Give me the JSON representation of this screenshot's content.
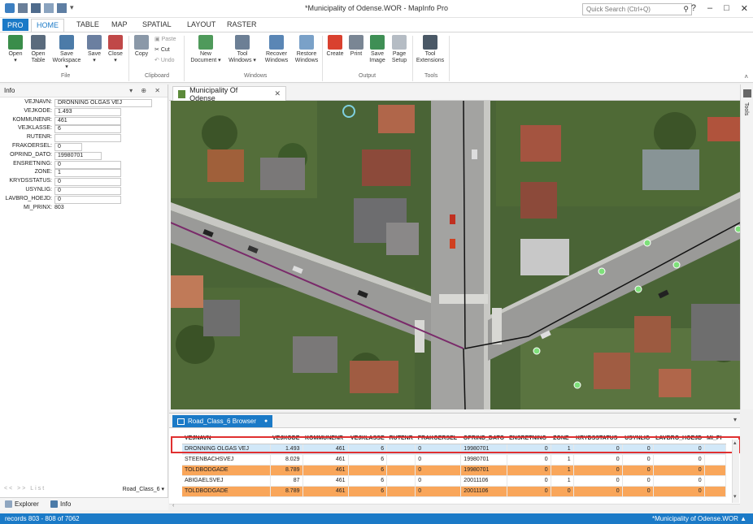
{
  "window": {
    "title": "*Municipality of Odense.WOR - MapInfo Pro",
    "quick_search_placeholder": "Quick Search (Ctrl+Q)",
    "help": "?",
    "minimize": "–",
    "maximize": "□",
    "close": "✕"
  },
  "ribbon_tabs": [
    "PRO",
    "HOME",
    "TABLE",
    "MAP",
    "SPATIAL",
    "LAYOUT",
    "RASTER"
  ],
  "ribbon": {
    "file": {
      "label": "File",
      "open": "Open",
      "open_table": "Open Table",
      "save_workspace": "Save Workspace",
      "save": "Save",
      "close": "Close"
    },
    "clipboard": {
      "label": "Clipboard",
      "copy": "Copy",
      "paste": "Paste",
      "cut": "Cut",
      "undo": "Undo"
    },
    "windows": {
      "label": "Windows",
      "new_document": "New Document",
      "tool_windows": "Tool Windows",
      "recover_windows": "Recover Windows",
      "restore_windows": "Restore Windows"
    },
    "output": {
      "label": "Output",
      "create": "Create",
      "print": "Print",
      "save_image": "Save Image",
      "page_setup": "Page Setup"
    },
    "tools": {
      "label": "Tools",
      "tool_extensions": "Tool Extensions"
    }
  },
  "info_panel": {
    "title": "Info",
    "fields": [
      {
        "label": "VEJNAVN:",
        "value": "DRONNING OLGAS VEJ"
      },
      {
        "label": "VEJKODE:",
        "value": "1.493"
      },
      {
        "label": "KOMMUNENR:",
        "value": "461"
      },
      {
        "label": "VEJKLASSE:",
        "value": "6"
      },
      {
        "label": "RUTENR:",
        "value": ""
      },
      {
        "label": "FRAKOERSEL:",
        "value": "0"
      },
      {
        "label": "OPRIND_DATO:",
        "value": "19980701"
      },
      {
        "label": "ENSRETNING:",
        "value": "0"
      },
      {
        "label": "ZONE:",
        "value": "1"
      },
      {
        "label": "KRYDSSTATUS:",
        "value": "0"
      },
      {
        "label": "USYNLIG:",
        "value": "0"
      },
      {
        "label": "LAVBRO_HOEJD:",
        "value": "0"
      },
      {
        "label": "MI_PRINX:",
        "value": "803"
      }
    ],
    "nav_buttons": "<< >> List",
    "layer_name": "Road_Class_6",
    "tabs": [
      "Explorer",
      "Info"
    ]
  },
  "map_window": {
    "tab_title": "Municipality Of Odense",
    "tools_label": "Tools"
  },
  "browser": {
    "tab_title": "Road_Class_6 Browser",
    "columns": [
      "VEJNAVN",
      "VEJKODE",
      "KOMMUNENR",
      "VEJKLASSE",
      "RUTENR",
      "FRAKOERSEL",
      "OPRIND_DATO",
      "ENSRETNING",
      "ZONE",
      "KRYDSSTATUS",
      "USYNLIG",
      "LAVBRO_HOEJD",
      "MI_PI"
    ],
    "rows": [
      [
        "DRONNING OLGAS VEJ",
        "1.493",
        "461",
        "6",
        "",
        "0",
        "19980701",
        "0",
        "1",
        "0",
        "0",
        "0",
        ""
      ],
      [
        "STEENBACHSVEJ",
        "8.029",
        "461",
        "6",
        "",
        "0",
        "19980701",
        "0",
        "1",
        "0",
        "0",
        "0",
        ""
      ],
      [
        "TOLDBODGADE",
        "8.789",
        "461",
        "6",
        "",
        "0",
        "19980701",
        "0",
        "1",
        "0",
        "0",
        "0",
        ""
      ],
      [
        "ABIGAELSVEJ",
        "87",
        "461",
        "6",
        "",
        "0",
        "20011106",
        "0",
        "1",
        "0",
        "0",
        "0",
        ""
      ],
      [
        "TOLDBODGADE",
        "8.789",
        "461",
        "6",
        "",
        "0",
        "20011106",
        "0",
        "0",
        "0",
        "0",
        "0",
        ""
      ]
    ]
  },
  "status": {
    "records": "records 803 - 808 of 7062",
    "workspace": "*Municipality of Odense.WOR"
  },
  "colors": {
    "accent": "#1b7ac7",
    "selected_row": "#d2e8f8",
    "highlight_row": "#f9a65a",
    "selection_outline": "#e03030"
  }
}
